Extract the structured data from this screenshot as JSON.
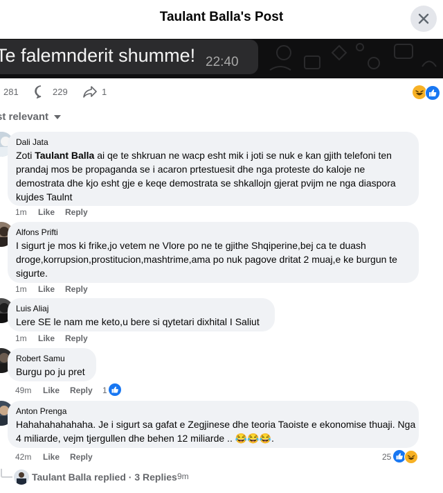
{
  "header": {
    "title": "Taulant Balla's Post"
  },
  "image_preview": {
    "message": "Te falemnderit shumme",
    "time": "22:40"
  },
  "stats": {
    "reactions": "281",
    "comments": "229",
    "shares": "1"
  },
  "sort": {
    "label": "st relevant"
  },
  "comments": [
    {
      "name": "Dali Jata",
      "text_prefix": "Zoti ",
      "mention": "Taulant Balla",
      "text": " ai qe te shkruan ne wacp esht mik i joti se nuk e kan gjith telefoni ten prandaj mos be propaganda se i acaron prtestuesit dhe nga proteste do kaloje ne demostrata dhe kjo esht gje e keqe demostrata se shkallojn gjerat pvijm ne nga diaspora kujdes Taulnt",
      "time": "1m",
      "like": "Like",
      "reply": "Reply"
    },
    {
      "name": "Alfons Prifti",
      "text": "I sigurt je mos ki frike,jo vetem ne Vlore po ne te gjithe Shqiperine,bej ca te duash droge,korrupsion,prostitucion,mashtrime,ama po nuk pagove dritat 2 muaj,e ke burgun te sigurte.",
      "time": "1m",
      "like": "Like",
      "reply": "Reply"
    },
    {
      "name": "Luis Aliaj",
      "text": "Lere SE le nam me keto,u bere si qytetari dixhital I Saliut",
      "time": "1m",
      "like": "Like",
      "reply": "Reply"
    },
    {
      "name": "Robert Samu",
      "text": "Burgu po ju pret",
      "time": "49m",
      "like": "Like",
      "reply": "Reply",
      "reactions": "1"
    },
    {
      "name": "Anton Prenga",
      "text": "Hahahahahahaha. Je i sigurt sa gafat e Zegjinese dhe teoria Taoiste e ekonomise thuaji. Nga 4 miliarde, vejm tjergullen dhe behen 12 miliarde .. 😂😂😂.",
      "time": "42m",
      "like": "Like",
      "reply": "Reply",
      "reactions": "25"
    }
  ],
  "replies": {
    "name": "Taulant Balla",
    "label": "replied",
    "count": "3 Replies",
    "time": "9m"
  },
  "colors": {
    "like_blue": "#1877f2",
    "haha_yellow": "#f7b125",
    "bubble_gray": "#f0f2f5",
    "muted": "#65676b"
  },
  "icons": [
    "close-icon",
    "comment-icon",
    "share-icon",
    "haha-icon",
    "like-icon",
    "sort-chevron-icon"
  ]
}
